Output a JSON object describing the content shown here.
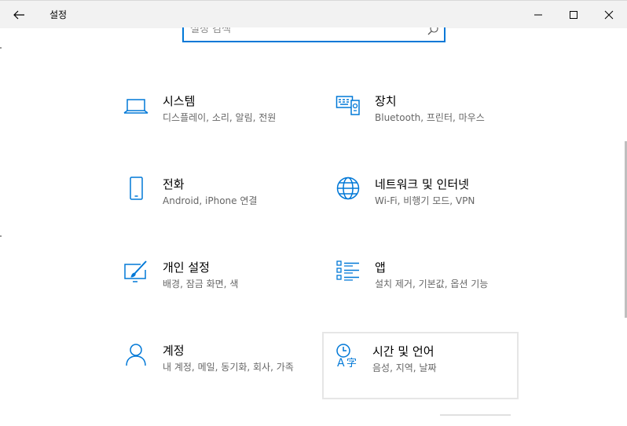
{
  "window": {
    "title": "설정"
  },
  "search": {
    "placeholder": "설정 검색"
  },
  "tiles": [
    {
      "title": "시스템",
      "desc": "디스플레이, 소리, 알림, 전원",
      "icon": "laptop-icon"
    },
    {
      "title": "장치",
      "desc": "Bluetooth, 프린터, 마우스",
      "icon": "devices-icon"
    },
    {
      "title": "전화",
      "desc": "Android, iPhone 연결",
      "icon": "phone-icon"
    },
    {
      "title": "네트워크 및 인터넷",
      "desc": "Wi-Fi, 비행기 모드, VPN",
      "icon": "globe-icon"
    },
    {
      "title": "개인 설정",
      "desc": "배경, 잠금 화면, 색",
      "icon": "personalization-icon"
    },
    {
      "title": "앱",
      "desc": "설치 제거, 기본값, 옵션 기능",
      "icon": "apps-list-icon"
    },
    {
      "title": "계정",
      "desc": "내 계정, 메일, 동기화, 회사, 가족",
      "icon": "person-icon"
    },
    {
      "title": "시간 및 언어",
      "desc": "음성, 지역, 날짜",
      "icon": "time-language-icon"
    }
  ],
  "colors": {
    "accent": "#0078d7",
    "titlebar": "#f2f2f2",
    "secondary_text": "#666666"
  }
}
